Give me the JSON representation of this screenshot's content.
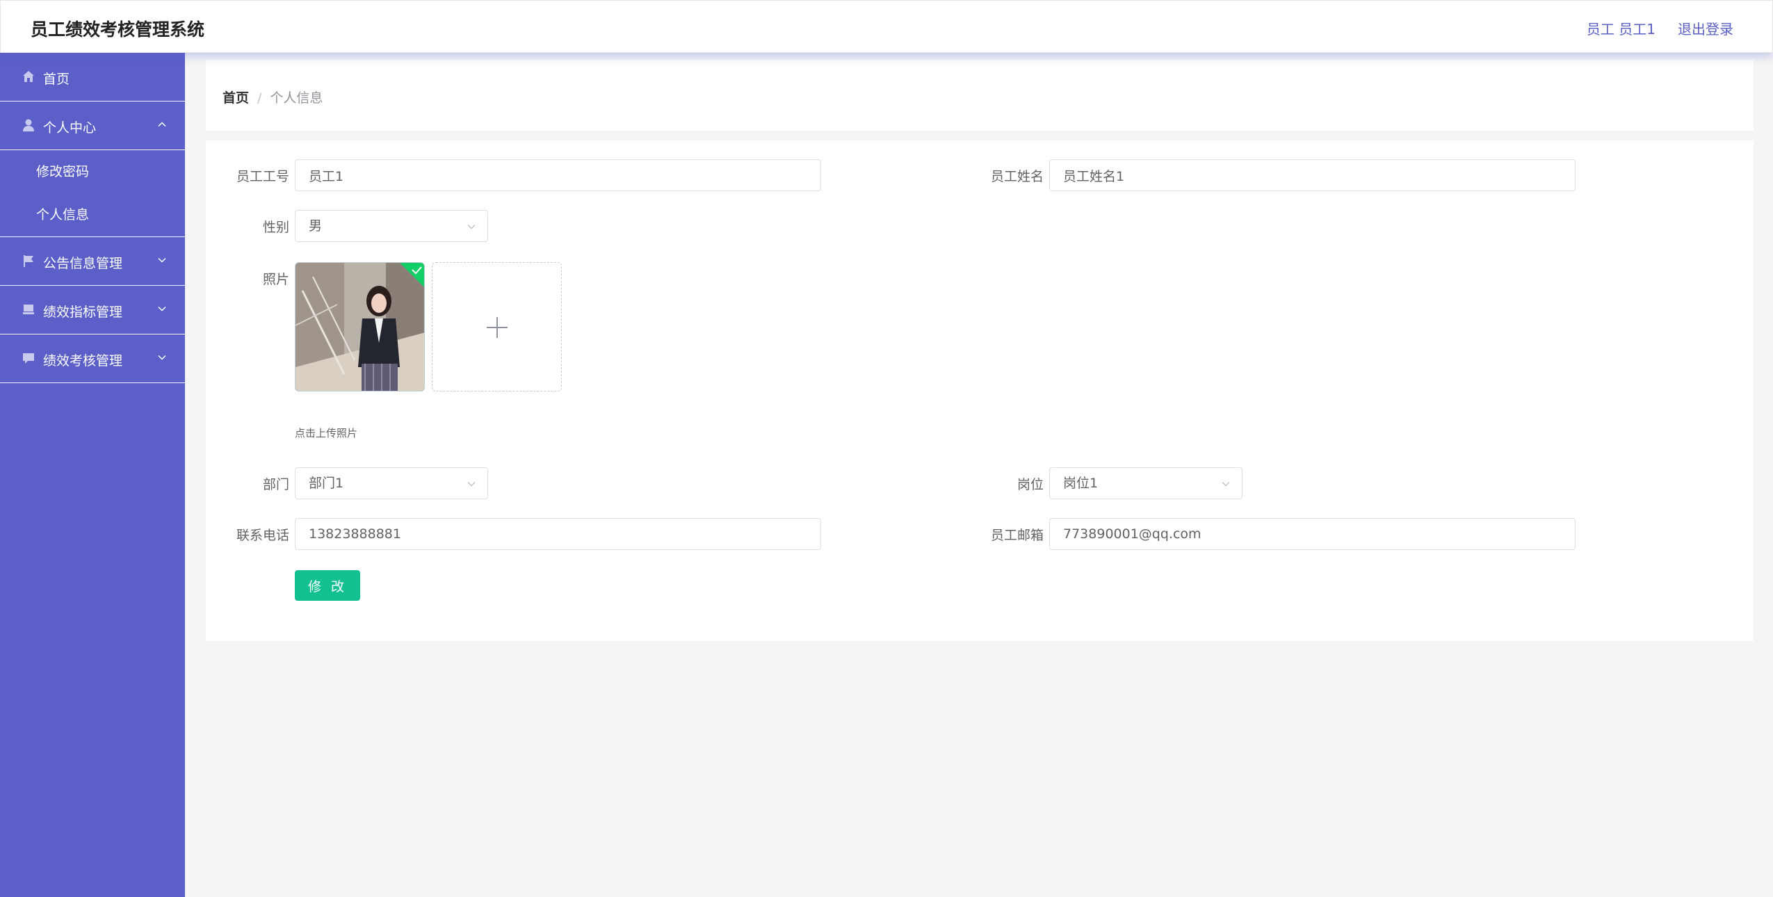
{
  "header": {
    "title": "员工绩效考核管理系统",
    "user_info": "员工 员工1",
    "logout_label": "退出登录"
  },
  "sidebar": {
    "items": [
      {
        "label": "首页",
        "icon": "home-icon"
      },
      {
        "label": "个人中心",
        "icon": "user-icon",
        "expanded": true,
        "children": [
          {
            "label": "修改密码"
          },
          {
            "label": "个人信息"
          }
        ]
      },
      {
        "label": "公告信息管理",
        "icon": "flag-icon"
      },
      {
        "label": "绩效指标管理",
        "icon": "tray-icon"
      },
      {
        "label": "绩效考核管理",
        "icon": "message-icon"
      }
    ]
  },
  "breadcrumb": {
    "home": "首页",
    "separator": "/",
    "current": "个人信息"
  },
  "form": {
    "employee_id": {
      "label": "员工工号",
      "value": "员工1"
    },
    "employee_name": {
      "label": "员工姓名",
      "value": "员工姓名1"
    },
    "gender": {
      "label": "性别",
      "value": "男"
    },
    "photo": {
      "label": "照片",
      "hint": "点击上传照片"
    },
    "department": {
      "label": "部门",
      "value": "部门1"
    },
    "position": {
      "label": "岗位",
      "value": "岗位1"
    },
    "phone": {
      "label": "联系电话",
      "value": "13823888881"
    },
    "email": {
      "label": "员工邮箱",
      "value": "773890001@qq.com"
    },
    "submit_label": "修 改"
  },
  "colors": {
    "sidebar_bg": "#5b5fc7",
    "accent": "#5a5fc4",
    "button": "#13c08f",
    "success_badge": "#13ce66"
  }
}
